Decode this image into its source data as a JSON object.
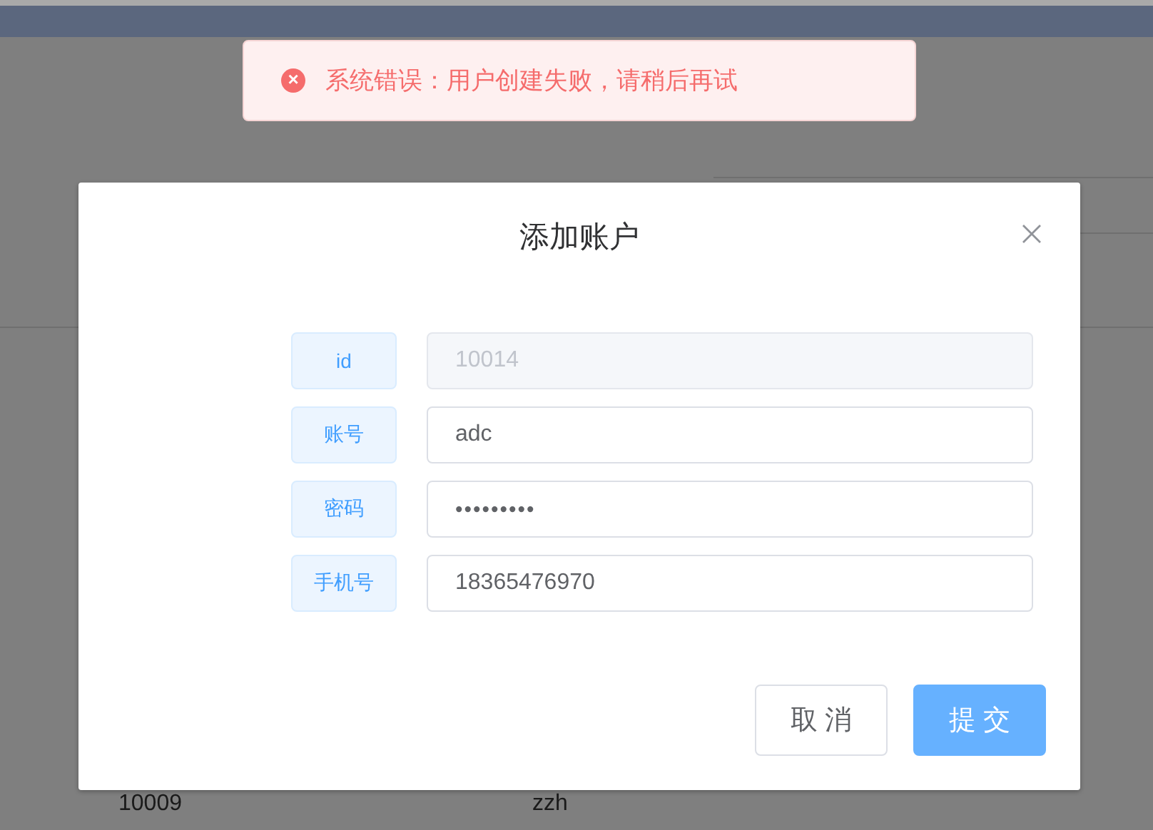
{
  "page": {
    "table_rows": [
      {
        "id": "10009",
        "account": "zzh"
      }
    ]
  },
  "toast": {
    "kind": "error",
    "icon": "×",
    "message": "系统错误：用户创建失败，请稍后再试"
  },
  "dialog": {
    "title": "添加账户",
    "fields": [
      {
        "label": "id",
        "value": "10014",
        "disabled": true,
        "masked": false
      },
      {
        "label": "账号",
        "value": "adc",
        "disabled": false,
        "masked": false
      },
      {
        "label": "密码",
        "value": "•••••••••",
        "disabled": false,
        "masked": true
      },
      {
        "label": "手机号",
        "value": "18365476970",
        "disabled": false,
        "masked": false
      }
    ],
    "buttons": [
      {
        "label": "取 消",
        "kind": "default"
      },
      {
        "label": "提 交",
        "kind": "primary"
      }
    ]
  }
}
